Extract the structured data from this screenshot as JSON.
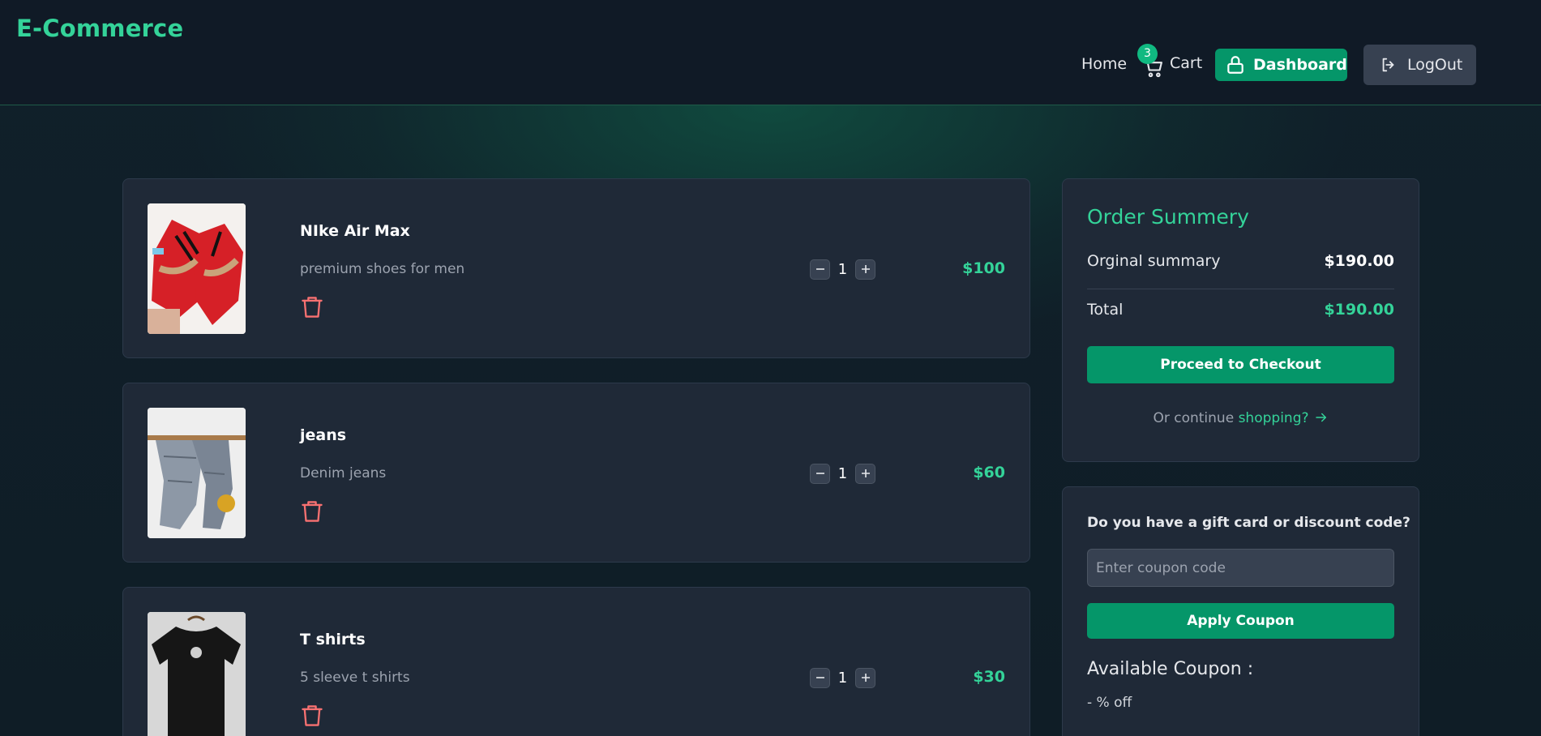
{
  "header": {
    "logo": "E-Commerce",
    "nav": {
      "home": "Home",
      "cart": "Cart",
      "cart_count": "3",
      "dashboard": "Dashboard",
      "logout": "LogOut"
    }
  },
  "cart": {
    "items": [
      {
        "name": "NIke Air Max",
        "description": "premium shoes for men",
        "quantity": "1",
        "price": "$100",
        "image_icon": "red-sneakers-image"
      },
      {
        "name": "jeans",
        "description": "Denim jeans",
        "quantity": "1",
        "price": "$60",
        "image_icon": "denim-jeans-image"
      },
      {
        "name": "T shirts",
        "description": "5 sleeve t shirts",
        "quantity": "1",
        "price": "$30",
        "image_icon": "black-tshirt-image"
      }
    ]
  },
  "summary": {
    "title": "Order Summery",
    "original_label": "Orginal summary",
    "original_value": "$190.00",
    "total_label": "Total",
    "total_value": "$190.00",
    "checkout_label": "Proceed to Checkout",
    "continue_prefix": "Or continue",
    "continue_link": "shopping?"
  },
  "coupon": {
    "question": "Do you have a gift card or discount code?",
    "placeholder": "Enter coupon code",
    "apply_label": "Apply Coupon",
    "available_title": "Available Coupon :",
    "available_item": "- % off"
  },
  "colors": {
    "accent": "#34d399",
    "button": "#059669",
    "card": "#1f2937",
    "delete": "#f87171"
  }
}
